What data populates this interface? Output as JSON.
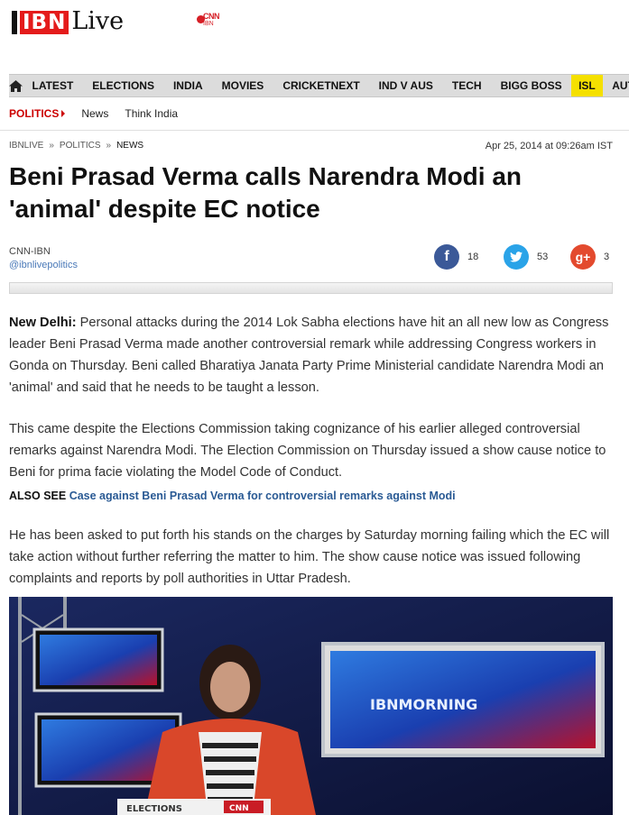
{
  "brand": {
    "logo_text": "IBN",
    "logo_live": "Live",
    "partner_badge": "CNN",
    "partner_sub": "IBN"
  },
  "nav": {
    "home_icon": "home-icon",
    "items": [
      "LATEST",
      "ELECTIONS",
      "INDIA",
      "MOVIES",
      "CRICKETNEXT",
      "IND V AUS",
      "TECH",
      "BIGG BOSS",
      "ISL",
      "AUTO"
    ],
    "highlight_color": "#f5e000"
  },
  "subnav": {
    "section": "POLITICS",
    "links": [
      "News",
      "Think India"
    ]
  },
  "breadcrumb": {
    "items": [
      "IBNLIVE",
      "POLITICS",
      "NEWS"
    ],
    "separator": "»"
  },
  "article": {
    "date": "Apr 25, 2014 at 09:26am IST",
    "headline": "Beni Prasad Verma calls Narendra Modi an 'animal' despite EC notice",
    "source": "CNN-IBN",
    "handle": "@ibnlivepolitics",
    "dateline": "New Delhi:",
    "para1": "Personal attacks during the 2014 Lok Sabha elections have hit an all new low as Congress leader Beni Prasad Verma made another controversial remark while addressing Congress workers in Gonda on Thursday. Beni called Bharatiya Janata Party Prime Ministerial candidate Narendra Modi an 'animal' and said that he needs to be taught a lesson.",
    "para2": "This came despite the Elections Commission taking cognizance of his earlier alleged controversial remarks against Narendra Modi. The Election Commission on Thursday issued a show cause notice to Beni for prima facie violating the Model Code of Conduct.",
    "also_see_label": "ALSO SEE",
    "also_see_link": "Case against Beni Prasad Verma for controversial remarks against Modi",
    "para3": "He has been asked to put forth his stands on the charges by Saturday morning failing which the EC will take action without further referring the matter to him. The show cause notice was issued following complaints and reports by poll authorities in Uttar Pradesh."
  },
  "social": {
    "facebook": {
      "glyph": "f",
      "count": "18",
      "color": "#3b5998",
      "icon": "facebook-icon"
    },
    "twitter": {
      "glyph": "t",
      "count": "53",
      "color": "#2aa3e8",
      "icon": "twitter-icon"
    },
    "googleplus": {
      "glyph": "g+",
      "count": "3",
      "color": "#e34a2e",
      "icon": "google-plus-icon"
    }
  },
  "video": {
    "screen_title": "IBNMORNING",
    "ticker": "ELECTIONS",
    "ticker_badge": "CNN"
  }
}
